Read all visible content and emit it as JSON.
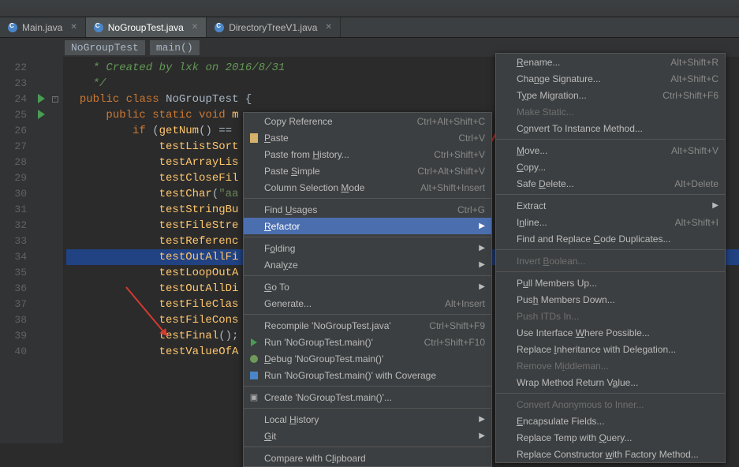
{
  "tabs": [
    {
      "label": "Main.java"
    },
    {
      "label": "NoGroupTest.java"
    },
    {
      "label": "DirectoryTreeV1.java"
    }
  ],
  "breadcrumb": {
    "class": "NoGroupTest",
    "method": "main()"
  },
  "lines": {
    "start": 22,
    "comment1": " * Created by lxk on 2016/8/31",
    "comment2": " */",
    "class_decl": {
      "kw1": "public",
      "kw2": "class",
      "name": "NoGroupTest",
      "brace": "{"
    },
    "main_decl": {
      "kw1": "public",
      "kw2": "static",
      "kw3": "void",
      "name": "m"
    },
    "if_line": {
      "kw": "if",
      "open": " (",
      "call": "getNum",
      "rest": "() == "
    },
    "calls": [
      "testListSort",
      "testArrayLis",
      "testCloseFil",
      "testChar",
      "testStringBu",
      "testFileStre",
      "testReferenc",
      "testOutAllFi",
      "testLoopOutA",
      "testOutAllDi",
      "testFileClas",
      "testFileCons",
      "testFinal",
      "testValueOfA"
    ],
    "char_arg": "\"aa",
    "final_tail": "();"
  },
  "menu1": [
    {
      "label": "Copy Reference",
      "sc": "Ctrl+Alt+Shift+C"
    },
    {
      "label": "Paste",
      "u": 0,
      "sc": "Ctrl+V",
      "icon": "paste"
    },
    {
      "label": "Paste from History...",
      "u": 11,
      "sc": "Ctrl+Shift+V"
    },
    {
      "label": "Paste Simple",
      "u": 6,
      "sc": "Ctrl+Alt+Shift+V"
    },
    {
      "label": "Column Selection Mode",
      "u": 17,
      "sc": "Alt+Shift+Insert"
    },
    {
      "sep": true
    },
    {
      "label": "Find Usages",
      "u": 5,
      "sc": "Ctrl+G"
    },
    {
      "label": "Refactor",
      "u": 0,
      "sub": true,
      "sel": true
    },
    {
      "sep": true
    },
    {
      "label": "Folding",
      "u": 1,
      "sub": true
    },
    {
      "label": "Analyze",
      "u": 4,
      "sub": true
    },
    {
      "sep": true
    },
    {
      "label": "Go To",
      "u": 0,
      "sub": true
    },
    {
      "label": "Generate...",
      "sc": "Alt+Insert"
    },
    {
      "sep": true
    },
    {
      "label": "Recompile 'NoGroupTest.java'",
      "sc": "Ctrl+Shift+F9"
    },
    {
      "label": "Run 'NoGroupTest.main()'",
      "sc": "Ctrl+Shift+F10",
      "icon": "run"
    },
    {
      "label": "Debug 'NoGroupTest.main()'",
      "u": 0,
      "icon": "debug"
    },
    {
      "label": "Run 'NoGroupTest.main()' with Coverage",
      "icon": "cov"
    },
    {
      "sep": true
    },
    {
      "label": "Create 'NoGroupTest.main()'...",
      "icon": "cre"
    },
    {
      "sep": true
    },
    {
      "label": "Local History",
      "u": 6,
      "sub": true
    },
    {
      "label": "Git",
      "u": 0,
      "sub": true
    },
    {
      "sep": true
    },
    {
      "label": "Compare with Clipboard",
      "u": 14
    }
  ],
  "menu2": [
    {
      "label": "Rename...",
      "u": 0,
      "sc": "Alt+Shift+R"
    },
    {
      "label": "Change Signature...",
      "u": 3,
      "sc": "Alt+Shift+C"
    },
    {
      "label": "Type Migration...",
      "u": 1,
      "sc": "Ctrl+Shift+F6"
    },
    {
      "label": "Make Static...",
      "dis": true
    },
    {
      "label": "Convert To Instance Method...",
      "u": 1
    },
    {
      "sep": true
    },
    {
      "label": "Move...",
      "u": 0,
      "sc": "Alt+Shift+V"
    },
    {
      "label": "Copy...",
      "u": 0
    },
    {
      "label": "Safe Delete...",
      "u": 5,
      "sc": "Alt+Delete"
    },
    {
      "sep": true
    },
    {
      "label": "Extract",
      "sub": true
    },
    {
      "label": "Inline...",
      "u": 1,
      "sc": "Alt+Shift+I"
    },
    {
      "label": "Find and Replace Code Duplicates...",
      "u": 17
    },
    {
      "sep": true
    },
    {
      "label": "Invert Boolean...",
      "u": 7,
      "dis": true
    },
    {
      "sep": true
    },
    {
      "label": "Pull Members Up...",
      "u": 1
    },
    {
      "label": "Push Members Down...",
      "u": 3
    },
    {
      "label": "Push ITDs In...",
      "dis": true
    },
    {
      "label": "Use Interface Where Possible...",
      "u": 14
    },
    {
      "label": "Replace Inheritance with Delegation...",
      "u": 8
    },
    {
      "label": "Remove Middleman...",
      "u": 8,
      "dis": true
    },
    {
      "label": "Wrap Method Return Value...",
      "u": 20
    },
    {
      "sep": true
    },
    {
      "label": "Convert Anonymous to Inner...",
      "dis": true
    },
    {
      "label": "Encapsulate Fields...",
      "u": 0
    },
    {
      "label": "Replace Temp with Query...",
      "u": 18
    },
    {
      "label": "Replace Constructor with Factory Method...",
      "u": 20
    }
  ]
}
